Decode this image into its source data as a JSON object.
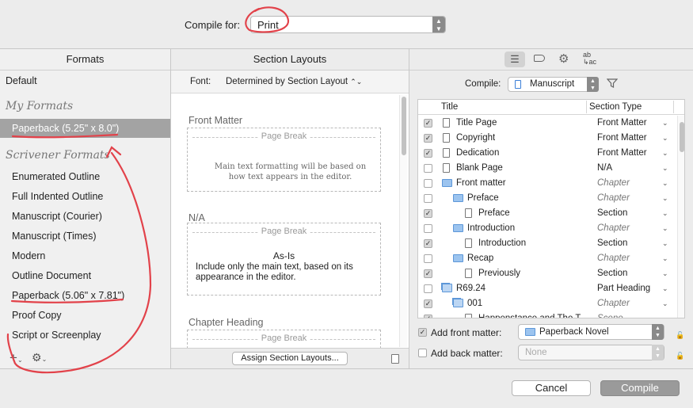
{
  "topbar": {
    "compile_for_label": "Compile for:",
    "compile_for_value": "Print"
  },
  "formats": {
    "header": "Formats",
    "default_label": "Default",
    "my_formats_heading": "My Formats",
    "my_formats": [
      "Paperback (5.25\" x 8.0\")"
    ],
    "scrivener_heading": "Scrivener Formats",
    "scrivener_formats": [
      "Enumerated Outline",
      "Full Indented Outline",
      "Manuscript (Courier)",
      "Manuscript (Times)",
      "Modern",
      "Outline Document",
      "Paperback (5.06\" x 7.81\")",
      "Proof Copy",
      "Script or Screenplay"
    ],
    "add_icon": "plus-icon",
    "settings_icon": "gear-icon"
  },
  "section_layouts": {
    "header": "Section Layouts",
    "font_label": "Font:",
    "font_value": "Determined by Section Layout",
    "layouts": [
      {
        "title": "Front Matter",
        "page_break": "Page Break",
        "heading": "",
        "body": "Main text formatting will be based on how text appears in the editor."
      },
      {
        "title": "N/A",
        "page_break": "Page Break",
        "heading": "As-Is",
        "body": "Include only the main text, based on its appearance in the editor."
      },
      {
        "title": "Chapter Heading",
        "page_break": "Page Break",
        "heading": "",
        "body": ""
      }
    ],
    "assign_button": "Assign Section Layouts..."
  },
  "contents": {
    "toolbar_icons": [
      "list-icon",
      "label-icon",
      "gear-icon",
      "replace-text-icon"
    ],
    "replace_icon_text": "ab\n↳ac",
    "compile_label": "Compile:",
    "compile_value": "Manuscript",
    "filter_icon": "filter-icon",
    "col_title": "Title",
    "col_type": "Section Type",
    "rows": [
      {
        "title": "Title Page",
        "type": "Front Matter",
        "checked": true,
        "icon": "document-icon",
        "indent": 0,
        "italic": false
      },
      {
        "title": "Copyright",
        "type": "Front Matter",
        "checked": true,
        "icon": "document-icon",
        "indent": 0,
        "italic": false
      },
      {
        "title": "Dedication",
        "type": "Front Matter",
        "checked": true,
        "icon": "document-icon",
        "indent": 0,
        "italic": false
      },
      {
        "title": "Blank Page",
        "type": "N/A",
        "checked": false,
        "icon": "document-icon",
        "indent": 0,
        "italic": false
      },
      {
        "title": "Front matter",
        "type": "Chapter",
        "checked": false,
        "icon": "folder-icon",
        "indent": 0,
        "italic": true
      },
      {
        "title": "Preface",
        "type": "Chapter",
        "checked": false,
        "icon": "folder-icon",
        "indent": 1,
        "italic": true
      },
      {
        "title": "Preface",
        "type": "Section",
        "checked": true,
        "icon": "document-icon",
        "indent": 2,
        "italic": false
      },
      {
        "title": "Introduction",
        "type": "Chapter",
        "checked": false,
        "icon": "folder-icon",
        "indent": 1,
        "italic": true
      },
      {
        "title": "Introduction",
        "type": "Section",
        "checked": true,
        "icon": "document-icon",
        "indent": 2,
        "italic": false
      },
      {
        "title": "Recap",
        "type": "Chapter",
        "checked": false,
        "icon": "folder-icon",
        "indent": 1,
        "italic": true
      },
      {
        "title": "Previously",
        "type": "Section",
        "checked": true,
        "icon": "document-icon",
        "indent": 2,
        "italic": false
      },
      {
        "title": "R69.24",
        "type": "Part Heading",
        "checked": false,
        "icon": "folder-stack-icon",
        "indent": 0,
        "italic": false
      },
      {
        "title": "001",
        "type": "Chapter",
        "checked": true,
        "icon": "folder-stack-icon",
        "indent": 1,
        "italic": true
      },
      {
        "title": "Happenstance and The T",
        "type": "Scene",
        "checked": true,
        "icon": "document-icon",
        "indent": 2,
        "italic": true
      }
    ],
    "add_front_label": "Add front matter:",
    "add_front_value": "Paperback Novel",
    "add_back_label": "Add back matter:",
    "add_back_value": "None"
  },
  "bottom": {
    "cancel": "Cancel",
    "compile": "Compile"
  },
  "colors": {
    "annotation": "#e2424a",
    "selected_row": "#a3a3a3"
  }
}
